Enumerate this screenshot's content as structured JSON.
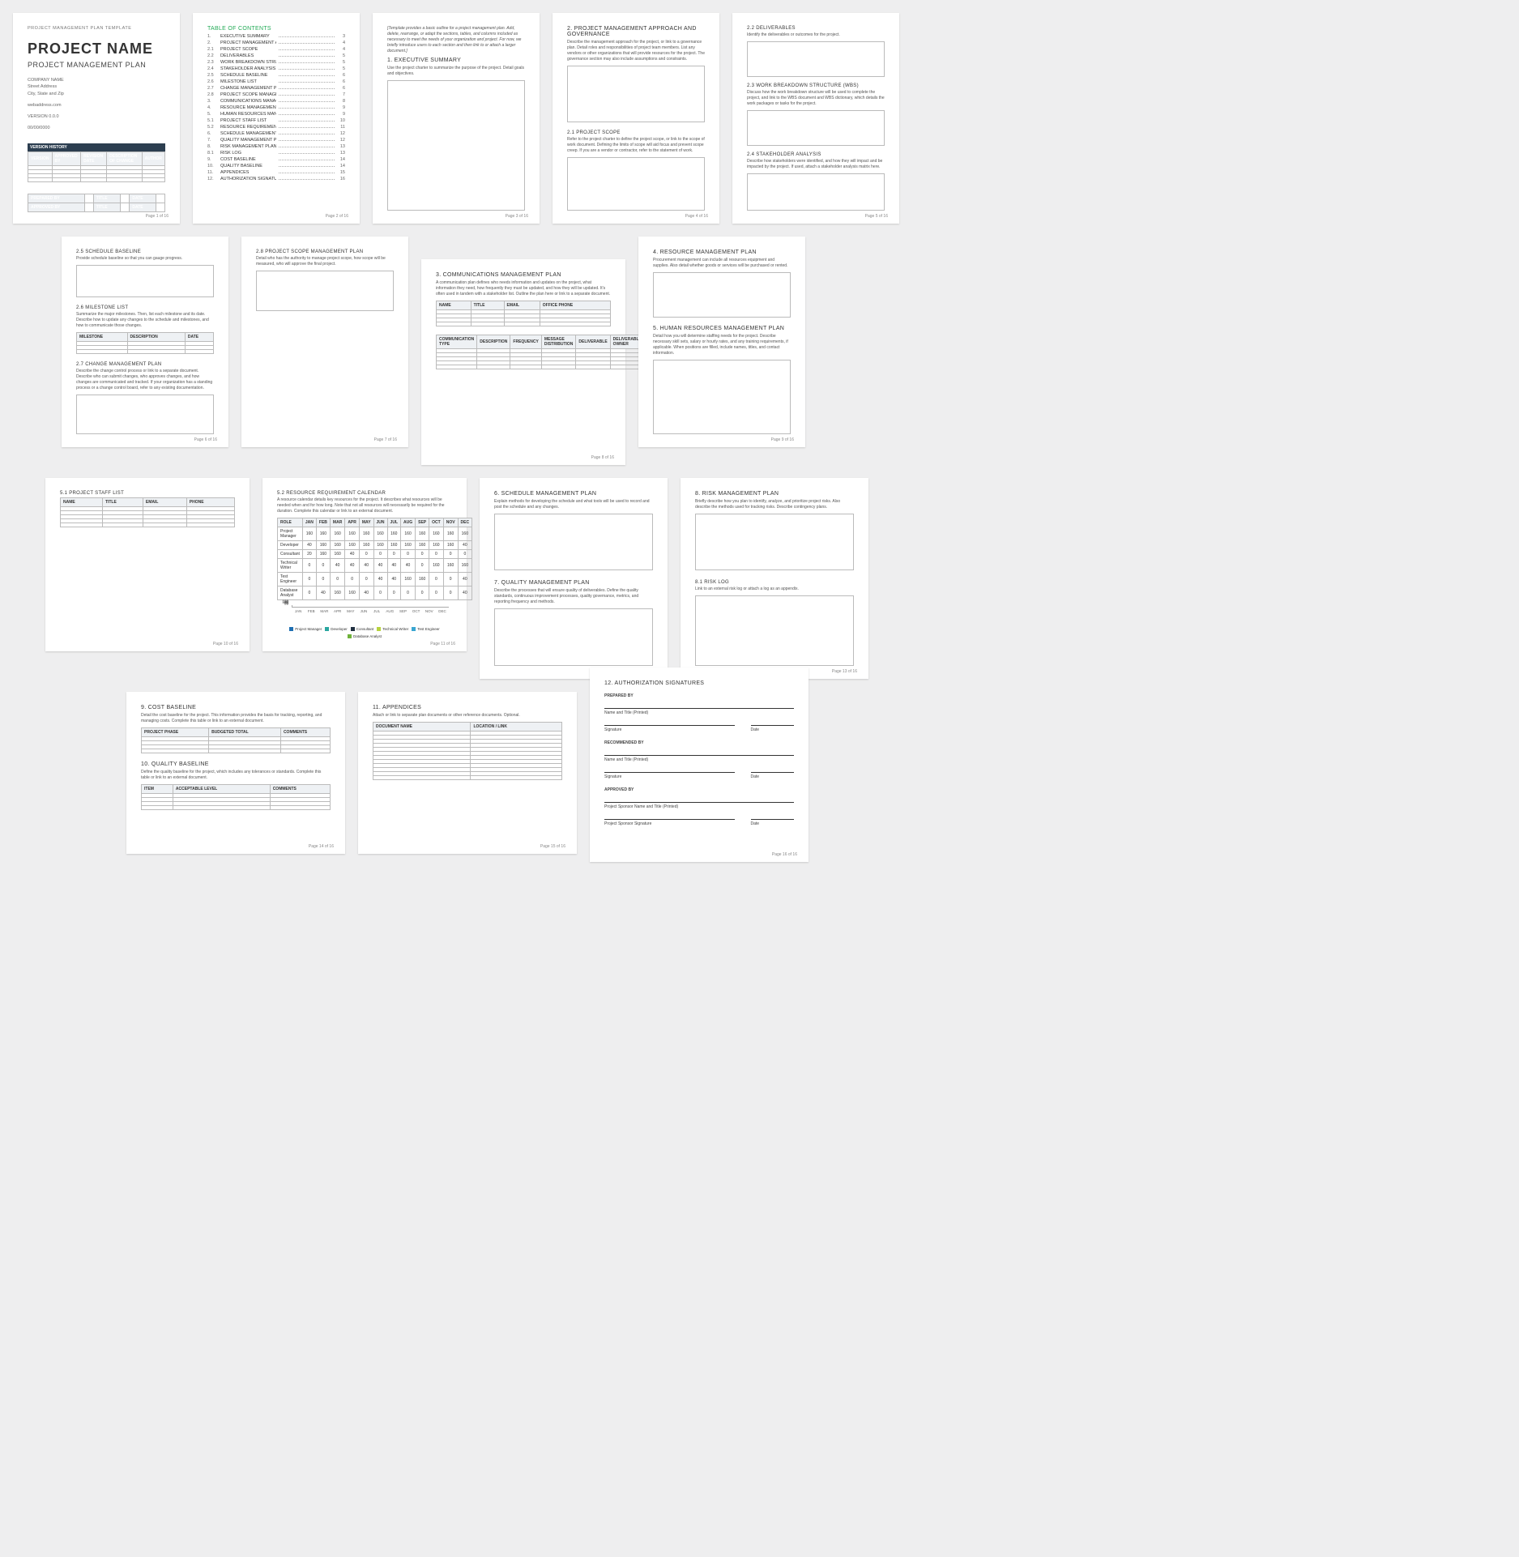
{
  "doc": {
    "templateLabel": "PROJECT MANAGEMENT PLAN TEMPLATE",
    "title": "PROJECT NAME",
    "subtitle": "PROJECT MANAGEMENT PLAN",
    "company": "COMPANY NAME",
    "addr1": "Street Address",
    "addr2": "City, State and Zip",
    "web": "webaddress.com",
    "version": "VERSION 0.0.0",
    "date": "00/00/0000",
    "versionHistory": {
      "title": "VERSION HISTORY",
      "cols": [
        "VERSION",
        "APPROVED BY",
        "REVISION DATE",
        "DESCRIPTION OF CHANGE",
        "AUTHOR"
      ]
    },
    "approval": {
      "rows": [
        "PREPARED BY",
        "APPROVED BY"
      ],
      "cols": [
        "TITLE",
        "DATE"
      ]
    }
  },
  "toc": {
    "title": "TABLE OF CONTENTS",
    "items": [
      {
        "n": "1.",
        "t": "EXECUTIVE SUMMARY",
        "p": "3"
      },
      {
        "n": "2.",
        "t": "PROJECT MANAGEMENT APPROACH AND GOVERNANCE",
        "p": "4"
      },
      {
        "n": "2.1",
        "t": "PROJECT SCOPE",
        "p": "4"
      },
      {
        "n": "2.2",
        "t": "DELIVERABLES",
        "p": "5"
      },
      {
        "n": "2.3",
        "t": "WORK BREAKDOWN STRUCTURE (WBS)",
        "p": "5"
      },
      {
        "n": "2.4",
        "t": "STAKEHOLDER ANALYSIS",
        "p": "5"
      },
      {
        "n": "2.5",
        "t": "SCHEDULE BASELINE",
        "p": "6"
      },
      {
        "n": "2.6",
        "t": "MILESTONE LIST",
        "p": "6"
      },
      {
        "n": "2.7",
        "t": "CHANGE MANAGEMENT PLAN",
        "p": "6"
      },
      {
        "n": "2.8",
        "t": "PROJECT SCOPE MANAGEMENT PLAN",
        "p": "7"
      },
      {
        "n": "3.",
        "t": "COMMUNICATIONS MANAGEMENT PLAN",
        "p": "8"
      },
      {
        "n": "4.",
        "t": "RESOURCE MANAGEMENT PLAN",
        "p": "9"
      },
      {
        "n": "5.",
        "t": "HUMAN RESOURCES MANAGEMENT PLAN",
        "p": "9"
      },
      {
        "n": "5.1",
        "t": "PROJECT STAFF LIST",
        "p": "10"
      },
      {
        "n": "5.2",
        "t": "RESOURCE REQUIREMENT CALENDAR",
        "p": "11"
      },
      {
        "n": "6.",
        "t": "SCHEDULE MANAGEMENT PLAN",
        "p": "12"
      },
      {
        "n": "7.",
        "t": "QUALITY MANAGEMENT PLAN",
        "p": "12"
      },
      {
        "n": "8.",
        "t": "RISK MANAGEMENT PLAN",
        "p": "13"
      },
      {
        "n": "8.1",
        "t": "RISK LOG",
        "p": "13"
      },
      {
        "n": "9.",
        "t": "COST BASELINE",
        "p": "14"
      },
      {
        "n": "10.",
        "t": "QUALITY BASELINE",
        "p": "14"
      },
      {
        "n": "11.",
        "t": "APPENDICES",
        "p": "15"
      },
      {
        "n": "12.",
        "t": "AUTHORIZATION SIGNATURES",
        "p": "16"
      }
    ]
  },
  "pages": {
    "p3": {
      "intro": "[Template provides a basic outline for a project management plan. Add, delete, rearrange, or adapt the sections, tables, and columns included as necessary to meet the needs of your organization and project. For now, we briefly introduce users to each section and then link to or attach a larger document.]",
      "h": "1. EXECUTIVE SUMMARY",
      "d": "Use the project charter to summarize the purpose of the project. Detail goals and objectives."
    },
    "p4": {
      "h": "2. PROJECT MANAGEMENT APPROACH AND GOVERNANCE",
      "d": "Describe the management approach for the project, or link to a governance plan. Detail roles and responsibilities of project team members. List any vendors or other organizations that will provide resources for the project. The governance section may also include assumptions and constraints.",
      "s1": "2.1   PROJECT SCOPE",
      "s1d": "Refer to the project charter to define the project scope, or link to the scope of work document. Defining the limits of scope will aid focus and prevent scope creep. If you are a vendor or contractor, refer to the statement of work."
    },
    "p5": {
      "s1": "2.2   DELIVERABLES",
      "s1d": "Identify the deliverables or outcomes for the project.",
      "s2": "2.3   WORK BREAKDOWN STRUCTURE (WBS)",
      "s2d": "Discuss how the work breakdown structure will be used to complete the project, and link to the WBS document and WBS dictionary, which details the work packages or tasks for the project.",
      "s3": "2.4   STAKEHOLDER ANALYSIS",
      "s3d": "Describe how stakeholders were identified, and how they will impact and be impacted by the project. If used, attach a stakeholder analysis matrix here."
    },
    "p6": {
      "s1": "2.5   SCHEDULE BASELINE",
      "s1d": "Provide schedule baseline so that you can gauge progress.",
      "s2": "2.6   MILESTONE LIST",
      "s2d": "Summarize the major milestones. Then, list each milestone and its date. Describe how to update any changes to the schedule and milestones, and how to communicate those changes.",
      "s2cols": [
        "MILESTONE",
        "DESCRIPTION",
        "DATE"
      ],
      "s3": "2.7   CHANGE MANAGEMENT PLAN",
      "s3d": "Describe the change control process or link to a separate document. Describe who can submit changes, who approves changes, and how changes are communicated and tracked. If your organization has a standing process or a change control board, refer to any existing documentation."
    },
    "p7": {
      "s1": "2.8   PROJECT SCOPE MANAGEMENT PLAN",
      "s1d": "Detail who has the authority to manage project scope, how scope will be measured, who will approve the final project."
    },
    "p8": {
      "h": "3. COMMUNICATIONS MANAGEMENT PLAN",
      "d": "A communication plan defines who needs information and updates on the project, what information they need, how frequently they must be updated, and how they will be updated. It's often used in tandem with a stakeholder list. Outline the plan here or link to a separate document.",
      "t1cols": [
        "NAME",
        "TITLE",
        "EMAIL",
        "OFFICE PHONE"
      ],
      "t2cols": [
        "COMMUNICATION TYPE",
        "DESCRIPTION",
        "FREQUENCY",
        "MESSAGE DISTRIBUTION",
        "DELIVERABLE",
        "DELIVERABLE OWNER"
      ]
    },
    "p9": {
      "h1": "4. RESOURCE MANAGEMENT PLAN",
      "d1": "Procurement management can include all resources equipment and supplies. Also detail whether goods or services will be purchased or rented.",
      "h2": "5. HUMAN RESOURCES MANAGEMENT PLAN",
      "d2": "Detail how you will determine staffing needs for the project. Describe necessary skill sets, salary or hourly rates, and any training requirements, if applicable. When positions are filled, include names, titles, and contact information."
    },
    "p10": {
      "h": "5.1   PROJECT STAFF LIST",
      "cols": [
        "NAME",
        "TITLE",
        "EMAIL",
        "PHONE"
      ]
    },
    "p11": {
      "h": "5.2   RESOURCE REQUIREMENT CALENDAR",
      "d": "A resource calendar details key resources for the project. It describes what resources will be needed when and for how long. Note that not all resources will necessarily be required for the duration. Complete this calendar or link to an external document."
    },
    "p12": {
      "h1": "6. SCHEDULE MANAGEMENT PLAN",
      "d1": "Explain methods for developing the schedule and what tools will be used to record and post the schedule and any changes.",
      "h2": "7. QUALITY MANAGEMENT PLAN",
      "d2": "Describe the processes that will ensure quality of deliverables. Define the quality standards, continuous improvement processes, quality governance, metrics, and reporting frequency and methods."
    },
    "p13": {
      "h1": "8. RISK MANAGEMENT PLAN",
      "d1": "Briefly describe how you plan to identify, analyze, and prioritize project risks. Also describe the methods used for tracking risks. Describe contingency plans.",
      "h2": "8.1   RISK LOG",
      "d2": "Link to an external risk log or attach a log as an appendix."
    },
    "p14": {
      "h1": "9. COST BASELINE",
      "d1": "Detail the cost baseline for the project. This information provides the basis for tracking, reporting, and managing costs. Complete this table or link to an external document.",
      "t1cols": [
        "PROJECT PHASE",
        "BUDGETED TOTAL",
        "COMMENTS"
      ],
      "h2": "10. QUALITY BASELINE",
      "d2": "Define the quality baseline for the project, which includes any tolerances or standards. Complete this table or link to an external document.",
      "t2cols": [
        "ITEM",
        "ACCEPTABLE LEVEL",
        "COMMENTS"
      ]
    },
    "p15": {
      "h": "11. APPENDICES",
      "d": "Attach or link to separate plan documents or other reference documents. Optional.",
      "cols": [
        "DOCUMENT NAME",
        "LOCATION / LINK"
      ]
    },
    "p16": {
      "h": "12. AUTHORIZATION SIGNATURES",
      "prep": "PREPARED BY",
      "rec": "RECOMMENDED BY",
      "app": "APPROVED BY",
      "l1": "Name and Title  (Printed)",
      "l2": "Signature",
      "l3": "Date",
      "al1": "Project Sponsor Name and Title  (Printed)",
      "al2": "Project Sponsor Signature"
    }
  },
  "pageLabel": "Page {n} of 16",
  "chart_data": {
    "type": "bar",
    "title": "Resource Requirement Calendar",
    "xlabel": "",
    "ylabel": "",
    "x": [
      "JAN",
      "FEB",
      "MAR",
      "APR",
      "MAY",
      "JUN",
      "JUL",
      "AUG",
      "SEP",
      "OCT",
      "NOV",
      "DEC"
    ],
    "ylim": [
      0,
      180
    ],
    "yticks": [
      0,
      20,
      40,
      60,
      80,
      100,
      120,
      140,
      160,
      180
    ],
    "series": [
      {
        "name": "Project Manager",
        "color": "#1f6fb2",
        "values": [
          160,
          160,
          160,
          160,
          160,
          160,
          160,
          160,
          160,
          160,
          160,
          160
        ]
      },
      {
        "name": "Developer",
        "color": "#2aa7a0",
        "values": [
          40,
          160,
          160,
          160,
          160,
          160,
          160,
          160,
          160,
          160,
          160,
          40
        ]
      },
      {
        "name": "Consultant",
        "color": "#203040",
        "values": [
          20,
          160,
          160,
          40,
          0,
          0,
          0,
          0,
          0,
          0,
          0,
          0
        ]
      },
      {
        "name": "Technical Writer",
        "color": "#b7d23e",
        "values": [
          0,
          0,
          40,
          40,
          40,
          40,
          40,
          40,
          0,
          160,
          160,
          160
        ]
      },
      {
        "name": "Test Engineer",
        "color": "#3aa6d1",
        "values": [
          0,
          0,
          0,
          0,
          0,
          40,
          40,
          160,
          160,
          0,
          0,
          40
        ]
      },
      {
        "name": "Database Analyst",
        "color": "#6fb23a",
        "values": [
          0,
          40,
          160,
          160,
          40,
          0,
          0,
          0,
          0,
          0,
          0,
          40
        ]
      }
    ],
    "table": {
      "cols": [
        "ROLE",
        "JAN",
        "FEB",
        "MAR",
        "APR",
        "MAY",
        "JUN",
        "JUL",
        "AUG",
        "SEP",
        "OCT",
        "NOV",
        "DEC"
      ],
      "rows": [
        [
          "Project Manager",
          160,
          160,
          160,
          160,
          160,
          160,
          160,
          160,
          160,
          160,
          160,
          160
        ],
        [
          "Developer",
          40,
          160,
          160,
          160,
          160,
          160,
          160,
          160,
          160,
          160,
          160,
          40
        ],
        [
          "Consultant",
          20,
          160,
          160,
          40,
          0,
          0,
          0,
          0,
          0,
          0,
          0,
          0
        ],
        [
          "Technical Writer",
          0,
          0,
          40,
          40,
          40,
          40,
          40,
          40,
          0,
          160,
          160,
          160
        ],
        [
          "Test Engineer",
          0,
          0,
          0,
          0,
          0,
          40,
          40,
          160,
          160,
          0,
          0,
          40
        ],
        [
          "Database Analyst",
          0,
          40,
          160,
          160,
          40,
          0,
          0,
          0,
          0,
          0,
          0,
          40
        ]
      ]
    }
  }
}
